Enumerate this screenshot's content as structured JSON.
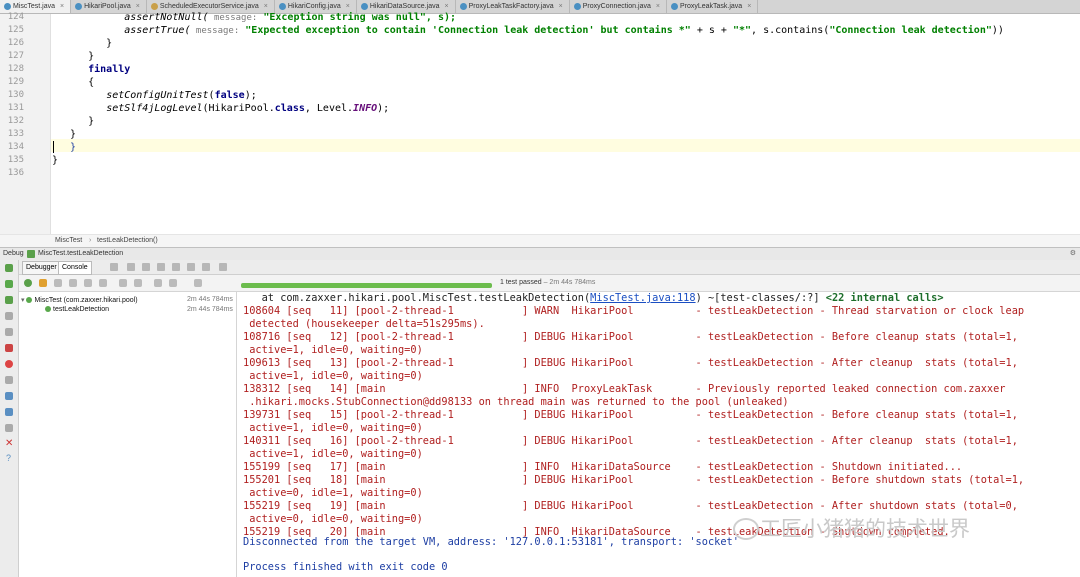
{
  "tabs": [
    {
      "label": "MiscTest.java"
    },
    {
      "label": "HikariPool.java"
    },
    {
      "label": "ScheduledExecutorService.java"
    },
    {
      "label": "HikariConfig.java"
    },
    {
      "label": "HikariDataSource.java"
    },
    {
      "label": "ProxyLeakTaskFactory.java"
    },
    {
      "label": "ProxyConnection.java"
    },
    {
      "label": "ProxyLeakTask.java"
    }
  ],
  "editor": {
    "line_numbers": [
      "124",
      "125",
      "126",
      "127",
      "128",
      "129",
      "130",
      "131",
      "132",
      "133",
      "134",
      "135",
      "136"
    ],
    "line124": {
      "pre": "            assertNotNull(",
      "hint": " message:",
      "post": " \"Exception string was null\", s);"
    },
    "line125": {
      "pre": "            assertTrue(",
      "hint": " message:",
      "str": " \"Expected exception to contain 'Connection leak detection' but contains *\"",
      "post": " + s + ",
      "str2": "\"*\"",
      "post2": ", s.contains(",
      "str3": "\"Connection leak detection\"",
      "post3": "))"
    },
    "line126": "         }",
    "line127": "      }",
    "line128": "      finally",
    "line129": "      {",
    "line130": {
      "pre": "         ",
      "fn": "setConfigUnitTest",
      "mid": "(",
      "kw": "false",
      "post": ");"
    },
    "line131": {
      "pre": "         ",
      "fn": "setSlf4jLogLevel",
      "mid": "(HikariPool.",
      "kw": "class",
      "post": ", Level.",
      "cst": "INFO",
      "post2": ");"
    },
    "line132": "      }",
    "line133": "   }",
    "line134": "   }",
    "line135": "}"
  },
  "breadcrumb": {
    "class": "MiscTest",
    "method": "testLeakDetection()"
  },
  "debug": {
    "title": "Debug",
    "config": "MiscTest.testLeakDetection",
    "tab_debugger": "Debugger",
    "tab_console": "Console"
  },
  "tests": {
    "status": "1 test passed",
    "duration_text": "– 2m 44s 784ms",
    "root": {
      "label": "MiscTest (com.zaxxer.hikari.pool)",
      "duration": "2m 44s 784ms"
    },
    "child": {
      "label": "testLeakDetection",
      "duration": "2m 44s 784ms"
    }
  },
  "console": {
    "line0_pre": "   at com.zaxxer.hikari.pool.MiscTest.testLeakDetection(",
    "line0_link": "MiscTest.java:118",
    "line0_post": ") ~[test-classes/:?] ",
    "line0_tail": "<22 internal calls>",
    "lines": [
      "108604 [seq   11] [pool-2-thread-1           ] WARN  HikariPool          - testLeakDetection - Thread starvation or clock leap",
      " detected (housekeeper delta=51s295ms).",
      "108716 [seq   12] [pool-2-thread-1           ] DEBUG HikariPool          - testLeakDetection - Before cleanup stats (total=1,",
      " active=1, idle=0, waiting=0)",
      "109613 [seq   13] [pool-2-thread-1           ] DEBUG HikariPool          - testLeakDetection - After cleanup  stats (total=1,",
      " active=1, idle=0, waiting=0)",
      "138312 [seq   14] [main                      ] INFO  ProxyLeakTask       - Previously reported leaked connection com.zaxxer",
      " .hikari.mocks.StubConnection@dd98133 on thread main was returned to the pool (unleaked)",
      "139731 [seq   15] [pool-2-thread-1           ] DEBUG HikariPool          - testLeakDetection - Before cleanup stats (total=1,",
      " active=1, idle=0, waiting=0)",
      "140311 [seq   16] [pool-2-thread-1           ] DEBUG HikariPool          - testLeakDetection - After cleanup  stats (total=1,",
      " active=1, idle=0, waiting=0)",
      "155199 [seq   17] [main                      ] INFO  HikariDataSource    - testLeakDetection - Shutdown initiated...",
      "155201 [seq   18] [main                      ] DEBUG HikariPool          - testLeakDetection - Before shutdown stats (total=1,",
      " active=0, idle=1, waiting=0)",
      "155219 [seq   19] [main                      ] DEBUG HikariPool          - testLeakDetection - After shutdown stats (total=0,",
      " active=0, idle=0, waiting=0)",
      "155219 [seq   20] [main                      ] INFO  HikariDataSource    - testLeakDetection - Shutdown completed."
    ],
    "disconnected": "Disconnected from the target VM, address: '127.0.0.1:53181', transport: 'socket'",
    "finished": "Process finished with exit code 0"
  },
  "watermark": "工匠小猪猪的技术世界"
}
